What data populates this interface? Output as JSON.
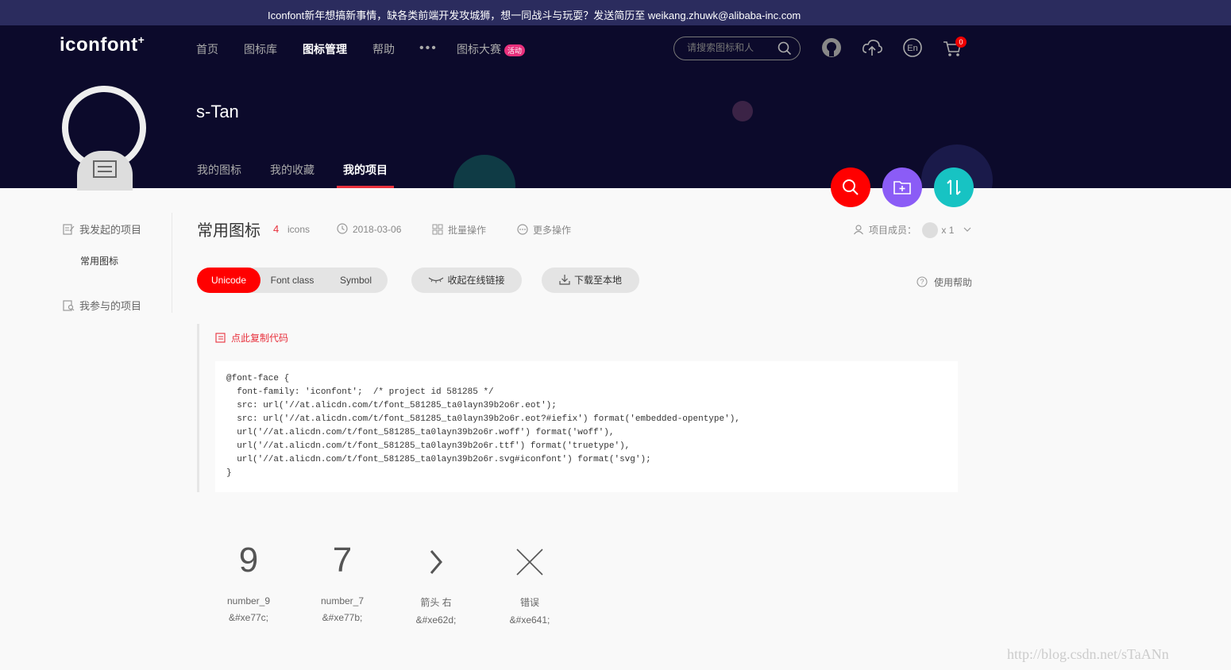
{
  "announcement": "Iconfont新年想搞新事情，缺各类前端开发攻城狮，想一同战斗与玩耍？发送简历至 weikang.zhuwk@alibaba-inc.com",
  "header": {
    "logo": "iconfont",
    "logo_mark": "+",
    "nav": [
      {
        "label": "首页",
        "active": false
      },
      {
        "label": "图标库",
        "active": false
      },
      {
        "label": "图标管理",
        "active": true
      },
      {
        "label": "帮助",
        "active": false
      }
    ],
    "more": "•••",
    "contest_label": "图标大赛",
    "contest_badge": "活动",
    "search_placeholder": "请搜索图标和人",
    "icons": [
      "github-icon",
      "upload-cloud-icon",
      "language-en-icon",
      "cart-icon"
    ],
    "cart_count": "0"
  },
  "profile": {
    "username": "s-Tan",
    "tabs": [
      {
        "label": "我的图标",
        "active": false
      },
      {
        "label": "我的收藏",
        "active": false
      },
      {
        "label": "我的项目",
        "active": true
      }
    ]
  },
  "fabs": [
    {
      "icon": "search-icon",
      "color": "#ff0000"
    },
    {
      "icon": "add-folder-icon",
      "color": "#8b5cf6"
    },
    {
      "icon": "sort-icon",
      "color": "#17c3c3"
    }
  ],
  "sidebar": {
    "created_label": "我发起的项目",
    "project": "常用图标",
    "joined_label": "我参与的项目"
  },
  "project": {
    "title": "常用图标",
    "count": "4",
    "count_unit": "icons",
    "date": "2018-03-06",
    "batch": "批量操作",
    "more": "更多操作",
    "members_label": "项目成员：",
    "members_count": "x 1"
  },
  "toolbar": {
    "tabs": [
      {
        "label": "Unicode",
        "active": true
      },
      {
        "label": "Font class",
        "active": false
      },
      {
        "label": "Symbol",
        "active": false
      }
    ],
    "collapse_link": "收起在线链接",
    "download": "下载至本地",
    "help": "使用帮助"
  },
  "code": {
    "copy_label": "点此复制代码",
    "text": "@font-face {\n  font-family: 'iconfont';  /* project id 581285 */\n  src: url('//at.alicdn.com/t/font_581285_ta0layn39b2o6r.eot');\n  src: url('//at.alicdn.com/t/font_581285_ta0layn39b2o6r.eot?#iefix') format('embedded-opentype'),\n  url('//at.alicdn.com/t/font_581285_ta0layn39b2o6r.woff') format('woff'),\n  url('//at.alicdn.com/t/font_581285_ta0layn39b2o6r.ttf') format('truetype'),\n  url('//at.alicdn.com/t/font_581285_ta0layn39b2o6r.svg#iconfont') format('svg');\n}"
  },
  "icons": [
    {
      "glyph": "9",
      "name": "number_9",
      "code": "&#xe77c;"
    },
    {
      "glyph": "7",
      "name": "number_7",
      "code": "&#xe77b;"
    },
    {
      "glyph": "",
      "name": "箭头 右",
      "code": "&#xe62d;"
    },
    {
      "glyph": "",
      "name": "错误",
      "code": "&#xe641;"
    }
  ],
  "watermark": "http://blog.csdn.net/sTaANn"
}
